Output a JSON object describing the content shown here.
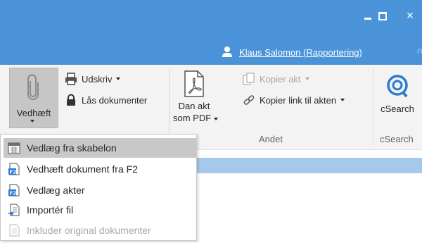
{
  "window": {
    "minimize_label": "",
    "maximize_label": "",
    "close_label": "×"
  },
  "user": {
    "name": "Klaus Salomon (Rapportering)",
    "extra": "∩"
  },
  "ribbon": {
    "vedhaeft_label": "Vedhæft",
    "udskriv_label": "Udskriv",
    "laas_label": "Lås dokumenter",
    "dan_akt_line1": "Dan akt",
    "dan_akt_line2": "som PDF",
    "kopier_akt_label": "Kopier akt",
    "kopier_link_label": "Kopier link til akten",
    "csearch_label": "cSearch",
    "group_andet": "Andet",
    "group_csearch": "cSearch"
  },
  "menu": {
    "items": [
      {
        "label": "Vedlæg fra skabelon",
        "icon": "calendar-template-icon",
        "highlighted": true,
        "disabled": false
      },
      {
        "label": "Vedhæft dokument fra F2",
        "icon": "f2-document-icon",
        "highlighted": false,
        "disabled": false
      },
      {
        "label": "Vedlæg akter",
        "icon": "f2-records-icon",
        "highlighted": false,
        "disabled": false
      },
      {
        "label": "Importér fil",
        "icon": "import-file-icon",
        "highlighted": false,
        "disabled": false
      },
      {
        "label": "Inkluder original dokumenter",
        "icon": "original-document-icon",
        "highlighted": false,
        "disabled": true
      }
    ]
  },
  "colors": {
    "titlebar": "#4a93d9",
    "ribbon": "#f3f3f3",
    "accent": "#2b7cd3",
    "highlight": "#c8c8c8",
    "strip": "#a6c9ea"
  }
}
